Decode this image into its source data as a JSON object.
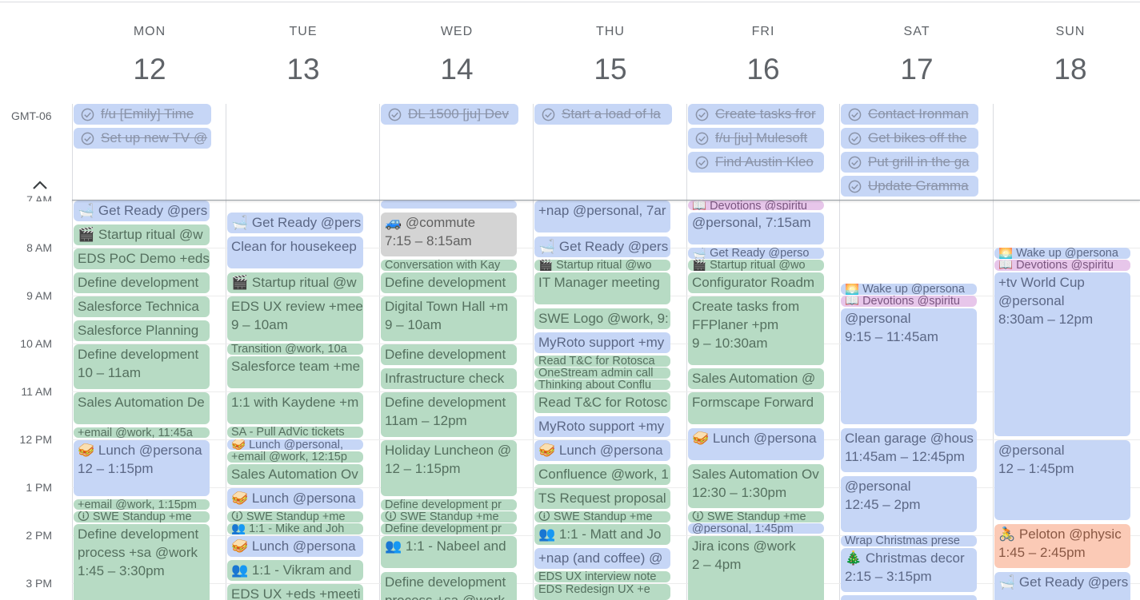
{
  "timezone": "GMT-06",
  "days": [
    {
      "dow": "MON",
      "num": "12"
    },
    {
      "dow": "TUE",
      "num": "13"
    },
    {
      "dow": "WED",
      "num": "14"
    },
    {
      "dow": "THU",
      "num": "15"
    },
    {
      "dow": "FRI",
      "num": "16"
    },
    {
      "dow": "SAT",
      "num": "17"
    },
    {
      "dow": "SUN",
      "num": "18"
    }
  ],
  "hours": [
    "7 AM",
    "8 AM",
    "9 AM",
    "10 AM",
    "11 AM",
    "12 PM",
    "1 PM",
    "2 PM",
    "3 PM"
  ],
  "tasks": [
    {
      "label": "f/u [Emily] Time"
    },
    {
      "label": "Set up new TV @"
    },
    {
      "label": "DL 1500 [ju] Dev"
    },
    {
      "label": "Start a load of la"
    },
    {
      "label": "Create tasks fror"
    },
    {
      "label": "f/u [ju] Mulesoft"
    },
    {
      "label": "Find Austin Kleo"
    },
    {
      "label": "Contact Ironman"
    },
    {
      "label": "Get bikes off the"
    },
    {
      "label": "Put grill in the ga"
    },
    {
      "label": "Update Gramma"
    }
  ],
  "events": [
    {
      "t1": "🛁 Get Ready @pers",
      "t2": ""
    },
    {
      "t1": "🎬 Startup ritual @w",
      "t2": ""
    },
    {
      "t1": "EDS PoC Demo +eds",
      "t2": ""
    },
    {
      "t1": "Define development",
      "t2": ""
    },
    {
      "t1": "Salesforce Technica",
      "t2": ""
    },
    {
      "t1": "Salesforce Planning",
      "t2": ""
    },
    {
      "t1": "Define development",
      "t2": "10 – 11am"
    },
    {
      "t1": "Sales Automation De",
      "t2": ""
    },
    {
      "t1": "+email @work, 11:45a",
      "t2": ""
    },
    {
      "t1": "🥪 Lunch @persona",
      "t2": "12 – 1:15pm"
    },
    {
      "t1": "+email @work, 1:15pm",
      "t2": ""
    },
    {
      "t1": "🛈 SWE Standup +me",
      "t2": ""
    },
    {
      "t1": "Define development",
      "t2": "process +sa @work",
      "t3": "1:45 – 3:30pm"
    },
    {
      "t1": "🛁 Get Ready @pers",
      "t2": ""
    },
    {
      "t1": "Clean for housekeep",
      "t2": ""
    },
    {
      "t1": "🎬 Startup ritual @w",
      "t2": ""
    },
    {
      "t1": "EDS UX review +mee",
      "t2": "9 – 10am"
    },
    {
      "t1": "Transition @work, 10a",
      "t2": ""
    },
    {
      "t1": "Salesforce team +me",
      "t2": ""
    },
    {
      "t1": "1:1 with Kaydene +m",
      "t2": ""
    },
    {
      "t1": "SA - Pull AdVic tickets",
      "t2": ""
    },
    {
      "t1": "🥪 Lunch @personal,",
      "t2": ""
    },
    {
      "t1": "+email @work, 12:15p",
      "t2": ""
    },
    {
      "t1": "Sales Automation Ov",
      "t2": ""
    },
    {
      "t1": "🥪 Lunch @persona",
      "t2": ""
    },
    {
      "t1": "🛈 SWE Standup +me",
      "t2": ""
    },
    {
      "t1": "👥 1:1 - Mike and Joh",
      "t2": ""
    },
    {
      "t1": "🥪 Lunch @persona",
      "t2": ""
    },
    {
      "t1": "👥 1:1 - Vikram and",
      "t2": ""
    },
    {
      "t1": "EDS UX +eds +meeti",
      "t2": ""
    },
    {
      "t1": "🚙 @commute",
      "t2": "7:15 – 8:15am"
    },
    {
      "t1": "Conversation with Kay",
      "t2": ""
    },
    {
      "t1": "Define development",
      "t2": ""
    },
    {
      "t1": "Digital Town Hall +m",
      "t2": "9 – 10am"
    },
    {
      "t1": "Define development",
      "t2": ""
    },
    {
      "t1": "Infrastructure check",
      "t2": ""
    },
    {
      "t1": "Define development",
      "t2": "11am – 12pm"
    },
    {
      "t1": "Holiday Luncheon @",
      "t2": "12 – 1:15pm"
    },
    {
      "t1": "Define development pr",
      "t2": ""
    },
    {
      "t1": "🛈 SWE Standup +me",
      "t2": ""
    },
    {
      "t1": "Define development pr",
      "t2": ""
    },
    {
      "t1": "👥 1:1 - Nabeel and",
      "t2": ""
    },
    {
      "t1": "Define development",
      "t2": "process +sa @work"
    },
    {
      "t1": "+nap @personal, 7ar",
      "t2": ""
    },
    {
      "t1": "🛁 Get Ready @pers",
      "t2": ""
    },
    {
      "t1": "🎬 Startup ritual @wo",
      "t2": ""
    },
    {
      "t1": "IT Manager meeting",
      "t2": ""
    },
    {
      "t1": "SWE Logo @work, 9:",
      "t2": ""
    },
    {
      "t1": "MyRoto support +my",
      "t2": ""
    },
    {
      "t1": "Read T&C for Rotosca",
      "t2": ""
    },
    {
      "t1": "OneStream admin call",
      "t2": ""
    },
    {
      "t1": "Thinking about Conflu",
      "t2": ""
    },
    {
      "t1": "Read T&C for Rotosc",
      "t2": ""
    },
    {
      "t1": "MyRoto support +my",
      "t2": ""
    },
    {
      "t1": "🥪 Lunch @persona",
      "t2": ""
    },
    {
      "t1": "Confluence @work, 1",
      "t2": ""
    },
    {
      "t1": "TS Request proposal",
      "t2": ""
    },
    {
      "t1": "🛈 SWE Standup +me",
      "t2": ""
    },
    {
      "t1": "👥 1:1 - Matt and Jo",
      "t2": ""
    },
    {
      "t1": "+nap (and coffee) @",
      "t2": ""
    },
    {
      "t1": "EDS UX interview note",
      "t2": ""
    },
    {
      "t1": "EDS Redesign UX +e",
      "t2": ""
    },
    {
      "t1": "📖 Devotions @spiritu",
      "t2": ""
    },
    {
      "t1": "@personal, 7:15am",
      "t2": ""
    },
    {
      "t1": "🛁 Get Ready @perso",
      "t2": ""
    },
    {
      "t1": "🎬 Startup ritual @wo",
      "t2": ""
    },
    {
      "t1": "Configurator Roadm",
      "t2": ""
    },
    {
      "t1": "Create tasks from",
      "t2": "FFPlaner +pm",
      "t3": "9 – 10:30am"
    },
    {
      "t1": "Sales Automation @",
      "t2": ""
    },
    {
      "t1": "Formscape Forward",
      "t2": ""
    },
    {
      "t1": "🥪 Lunch @persona",
      "t2": ""
    },
    {
      "t1": "Sales Automation Ov",
      "t2": "12:30 – 1:30pm"
    },
    {
      "t1": "🛈 SWE Standup +me",
      "t2": ""
    },
    {
      "t1": "@personal, 1:45pm",
      "t2": ""
    },
    {
      "t1": "Jira icons @work",
      "t2": "2 – 4pm"
    },
    {
      "t1": "🌅 Wake up @persona",
      "t2": ""
    },
    {
      "t1": "📖 Devotions @spiritu",
      "t2": ""
    },
    {
      "t1": "@personal",
      "t2": "9:15 – 11:45am"
    },
    {
      "t1": "Clean garage @hous",
      "t2": "11:45am – 12:45pm"
    },
    {
      "t1": "@personal",
      "t2": "12:45 – 2pm"
    },
    {
      "t1": "Wrap Christmas prese",
      "t2": ""
    },
    {
      "t1": "🎄 Christmas decor",
      "t2": "2:15 – 3:15pm"
    },
    {
      "t1": "🌅 Wake up @persona",
      "t2": ""
    },
    {
      "t1": "📖 Devotions @spiritu",
      "t2": ""
    },
    {
      "t1": "+tv World Cup",
      "t2": "@personal",
      "t3": "8:30am – 12pm"
    },
    {
      "t1": "@personal",
      "t2": "12 – 1:45pm"
    },
    {
      "t1": "🚴 Peloton @physic",
      "t2": "1:45 – 2:45pm"
    },
    {
      "t1": "🛁 Get Ready @pers",
      "t2": ""
    }
  ]
}
